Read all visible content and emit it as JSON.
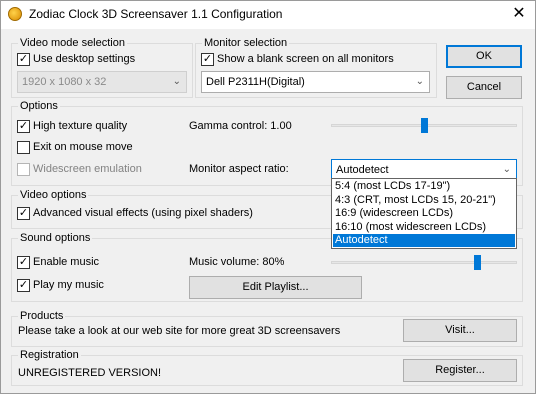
{
  "window": {
    "title": "Zodiac Clock 3D Screensaver 1.1 Configuration",
    "close_glyph": "✕"
  },
  "video_mode": {
    "label": "Video mode selection",
    "use_desktop_label": "Use desktop settings",
    "use_desktop_checked": true,
    "resolution": "1920 x 1080 x 32"
  },
  "monitor": {
    "label": "Monitor selection",
    "blank_label": "Show a blank screen on all monitors",
    "blank_checked": true,
    "selected": "Dell P2311H(Digital)"
  },
  "buttons": {
    "ok": "OK",
    "cancel": "Cancel"
  },
  "options": {
    "label": "Options",
    "high_texture_label": "High texture quality",
    "high_texture_checked": true,
    "exit_mouse_label": "Exit on mouse move",
    "exit_mouse_checked": false,
    "widescreen_label": "Widescreen emulation",
    "widescreen_checked": false,
    "gamma_label": "Gamma control: 1.00",
    "gamma_level_percent": 50,
    "aspect_label": "Monitor aspect ratio:",
    "aspect_selected": "Autodetect",
    "aspect_options": [
      "5:4 (most LCDs 17-19\")",
      "4:3 (CRT, most LCDs 15, 20-21\")",
      "16:9 (widescreen LCDs)",
      "16:10 (most widescreen LCDs)",
      "Autodetect"
    ],
    "aspect_highlighted_index": 4
  },
  "video_options": {
    "label": "Video options",
    "advanced_label": "Advanced visual effects (using pixel shaders)",
    "advanced_checked": true
  },
  "sound": {
    "label": "Sound options",
    "enable_music_label": "Enable music",
    "enable_music_checked": true,
    "play_music_label": "Play my music",
    "play_music_checked": true,
    "volume_label": "Music volume: 80%",
    "volume_percent": 80,
    "edit_playlist": "Edit Playlist..."
  },
  "products": {
    "label": "Products",
    "text": "Please take a look at our web site for more great 3D screensavers",
    "visit": "Visit..."
  },
  "registration": {
    "label": "Registration",
    "status": "UNREGISTERED VERSION!",
    "register": "Register..."
  },
  "colors": {
    "accent": "#0078d7",
    "disabled_text": "#838383"
  }
}
